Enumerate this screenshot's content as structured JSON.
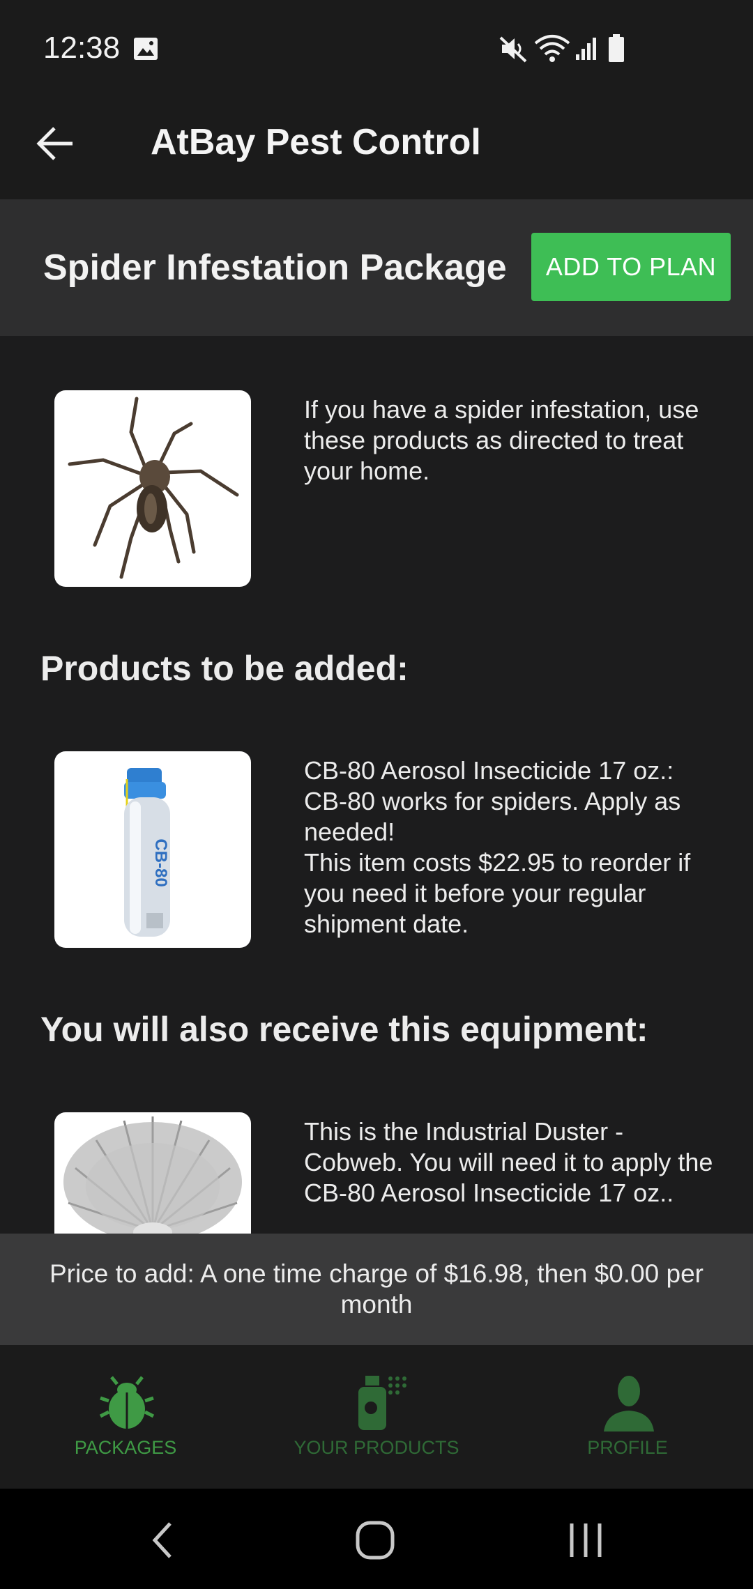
{
  "status_bar": {
    "time": "12:38"
  },
  "app_bar": {
    "title": "AtBay Pest Control"
  },
  "package": {
    "title": "Spider Infestation Package",
    "add_button": "ADD TO PLAN",
    "description": "If you have a spider infestation, use these products as directed to treat your home."
  },
  "products_section": {
    "heading": "Products to be added:",
    "items": [
      {
        "description": "CB-80 Aerosol Insecticide 17 oz.: CB-80 works for spiders. Apply as needed!\nThis item costs $22.95 to reorder if you need it before your regular shipment date.",
        "label_text": "CB-80"
      }
    ]
  },
  "equipment_section": {
    "heading": "You will also receive this equipment:",
    "items": [
      {
        "description": "This is the Industrial Duster - Cobweb. You will need it to apply the CB-80 Aerosol Insecticide 17 oz.."
      }
    ]
  },
  "price_bar": {
    "text": "Price to add: A one time charge of $16.98, then $0.00 per month"
  },
  "bottom_nav": {
    "items": [
      {
        "label": "PACKAGES",
        "icon": "bug-icon",
        "active": true
      },
      {
        "label": "YOUR PRODUCTS",
        "icon": "spray-icon",
        "active": false
      },
      {
        "label": "PROFILE",
        "icon": "person-icon",
        "active": false
      }
    ]
  },
  "colors": {
    "accent_green": "#3ebe55",
    "nav_active": "#3f9a45",
    "nav_inactive": "#2f6a36",
    "background": "#1c1c1d"
  }
}
